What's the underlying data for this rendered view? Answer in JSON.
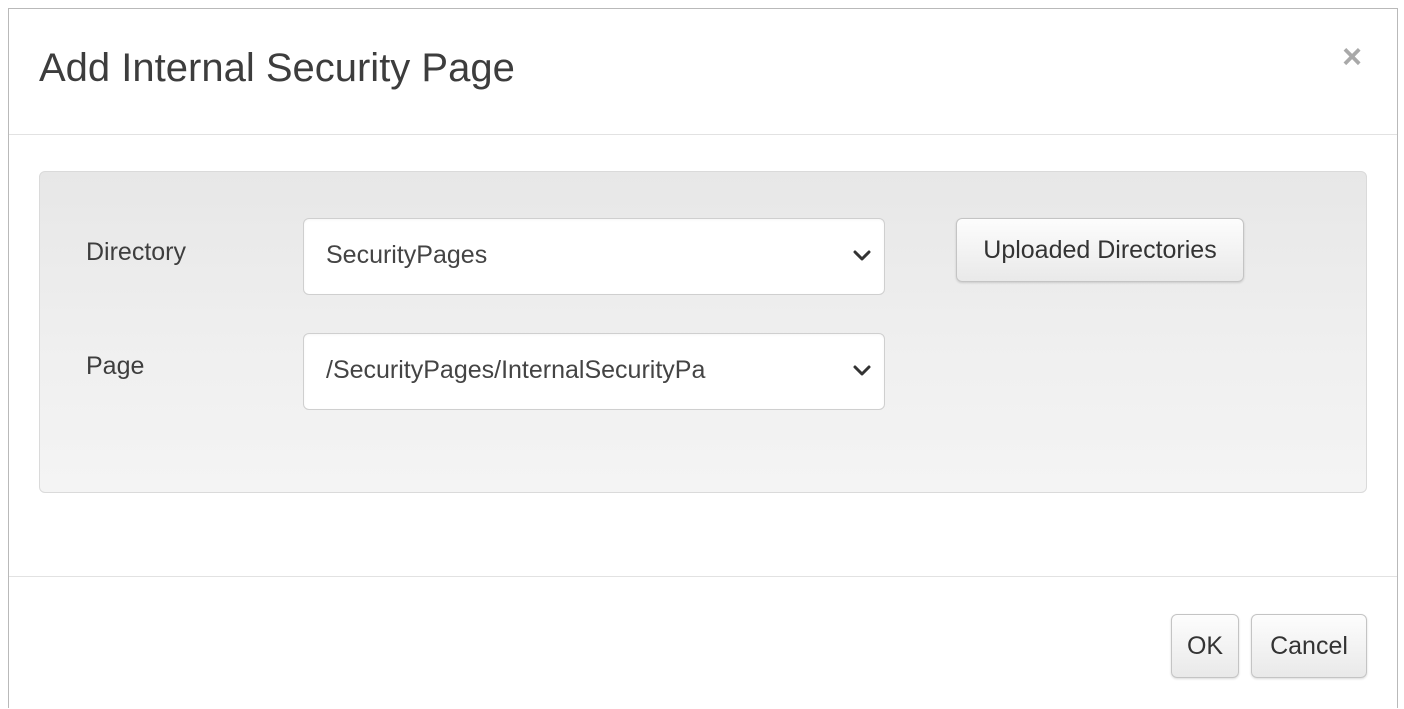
{
  "dialog": {
    "title": "Add Internal Security Page",
    "close_label": "×"
  },
  "form": {
    "directory": {
      "label": "Directory",
      "selected": "SecurityPages"
    },
    "page": {
      "label": "Page",
      "selected": "/SecurityPages/InternalSecurityPa"
    },
    "uploaded_directories_button": "Uploaded Directories"
  },
  "footer": {
    "ok_label": "OK",
    "cancel_label": "Cancel"
  },
  "icons": {
    "close": "close-icon",
    "dropdown": "chevron-down-icon"
  }
}
